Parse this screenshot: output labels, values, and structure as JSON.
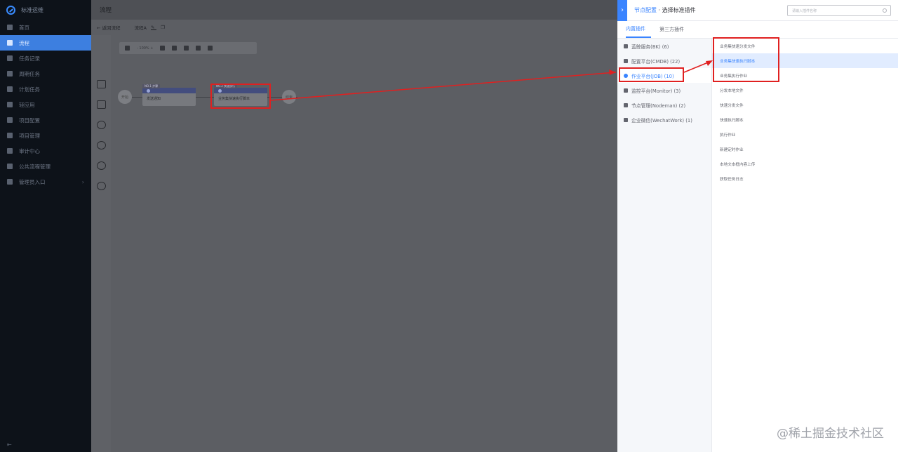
{
  "app": {
    "title": "标准运维"
  },
  "sidebar": {
    "items": [
      {
        "label": "首页",
        "active": false,
        "arrow": false
      },
      {
        "label": "流程",
        "active": true,
        "arrow": false
      },
      {
        "label": "任务记录",
        "active": false,
        "arrow": false
      },
      {
        "label": "周期任务",
        "active": false,
        "arrow": false
      },
      {
        "label": "计划任务",
        "active": false,
        "arrow": false
      },
      {
        "label": "轻应用",
        "active": false,
        "arrow": false
      },
      {
        "label": "项目配置",
        "active": false,
        "arrow": false
      },
      {
        "label": "项目管理",
        "active": false,
        "arrow": false
      },
      {
        "label": "审计中心",
        "active": false,
        "arrow": false
      },
      {
        "label": "公共流程管理",
        "active": false,
        "arrow": false
      },
      {
        "label": "管理员入口",
        "active": false,
        "arrow": true
      }
    ],
    "collapse_label": "⇤"
  },
  "main": {
    "title": "流程",
    "back_label": "← 返回流程",
    "template_name": "流程A"
  },
  "canvas": {
    "toolbar_zoom": "- 100% +",
    "start_label": "开始",
    "end_label": "结束",
    "task1": {
      "tag": "NO.1 步骤",
      "label": "发送通知"
    },
    "task2": {
      "tag": "NO.2 快速执行",
      "label": "业务集快速执行脚本"
    }
  },
  "panel": {
    "title_prefix": "节点配置",
    "title_sep": " · ",
    "title_suffix": "选择标准插件",
    "search_placeholder": "请输入插件名称",
    "tabs": [
      {
        "label": "内置插件",
        "active": true
      },
      {
        "label": "第三方插件",
        "active": false
      }
    ],
    "categories": [
      {
        "label": "蓝鲸服务(BK) (6)",
        "active": false
      },
      {
        "label": "配置平台(CMDB) (22)",
        "active": false
      },
      {
        "label": "作业平台(JOB) (10)",
        "active": true
      },
      {
        "label": "监控平台(Monitor) (3)",
        "active": false
      },
      {
        "label": "节点管理(Nodeman) (2)",
        "active": false
      },
      {
        "label": "企业微信(WechatWork) (1)",
        "active": false
      }
    ],
    "plugins": [
      {
        "label": "业务集快速分发文件",
        "active": false
      },
      {
        "label": "业务集快速执行脚本",
        "active": true
      },
      {
        "label": "业务集执行作业",
        "active": false
      },
      {
        "label": "分发本地文件",
        "active": false
      },
      {
        "label": "快速分发文件",
        "active": false
      },
      {
        "label": "快速执行脚本",
        "active": false
      },
      {
        "label": "执行作业",
        "active": false
      },
      {
        "label": "新建定时作业",
        "active": false
      },
      {
        "label": "本地文本框内容上传",
        "active": false
      },
      {
        "label": "获取任务日志",
        "active": false
      }
    ]
  },
  "watermark": "@稀土掘金技术社区",
  "colors": {
    "accent": "#3a84ff",
    "annotation": "#e02020"
  }
}
